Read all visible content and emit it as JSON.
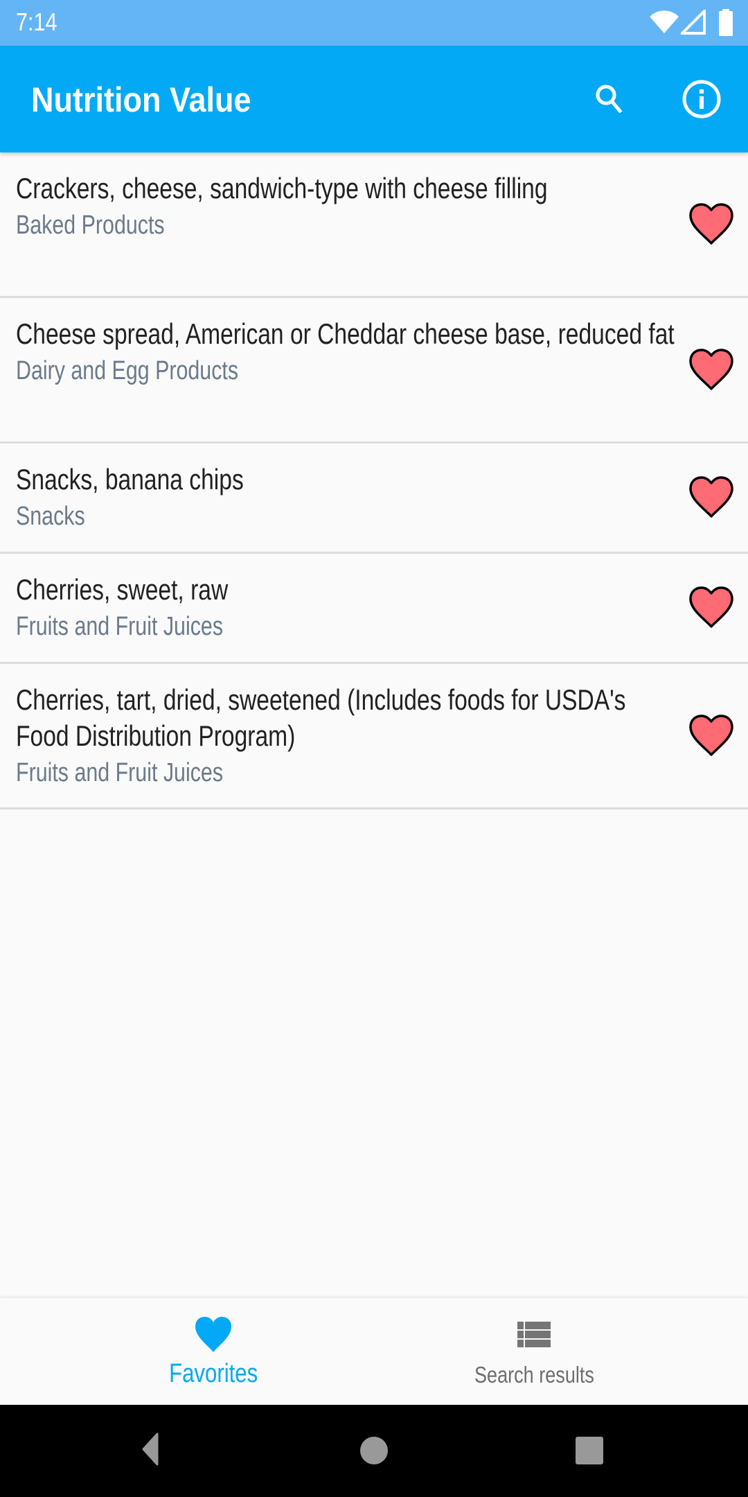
{
  "status_bar": {
    "time": "7:14",
    "icons": [
      "wifi-icon",
      "cell-signal-icon",
      "battery-icon"
    ]
  },
  "app_bar": {
    "title": "Nutrition Value",
    "actions": [
      {
        "name": "search",
        "icon": "search-icon"
      },
      {
        "name": "info",
        "icon": "info-icon"
      }
    ]
  },
  "favorites": [
    {
      "title": "Crackers, cheese, sandwich-type with cheese filling",
      "category": "Baked Products",
      "favorited": true
    },
    {
      "title": "Cheese spread, American or Cheddar cheese base, reduced fat",
      "category": "Dairy and Egg Products",
      "favorited": true
    },
    {
      "title": "Snacks, banana chips",
      "category": "Snacks",
      "favorited": true
    },
    {
      "title": "Cherries, sweet, raw",
      "category": "Fruits and Fruit Juices",
      "favorited": true
    },
    {
      "title": "Cherries, tart, dried, sweetened (Includes foods for USDA's Food Distribution Program)",
      "category": "Fruits and Fruit Juices",
      "favorited": true
    }
  ],
  "bottom_nav": {
    "items": [
      {
        "label": "Favorites",
        "icon": "heart-icon",
        "active": true
      },
      {
        "label": "Search results",
        "icon": "list-icon",
        "active": false
      }
    ]
  },
  "colors": {
    "status_bar": "#64B5F6",
    "primary": "#03A9F4",
    "heart_fill": "#FF6B75",
    "subtitle": "#6B7A8B",
    "inactive_nav": "#757575"
  },
  "system_nav": [
    "back",
    "home",
    "recents"
  ]
}
